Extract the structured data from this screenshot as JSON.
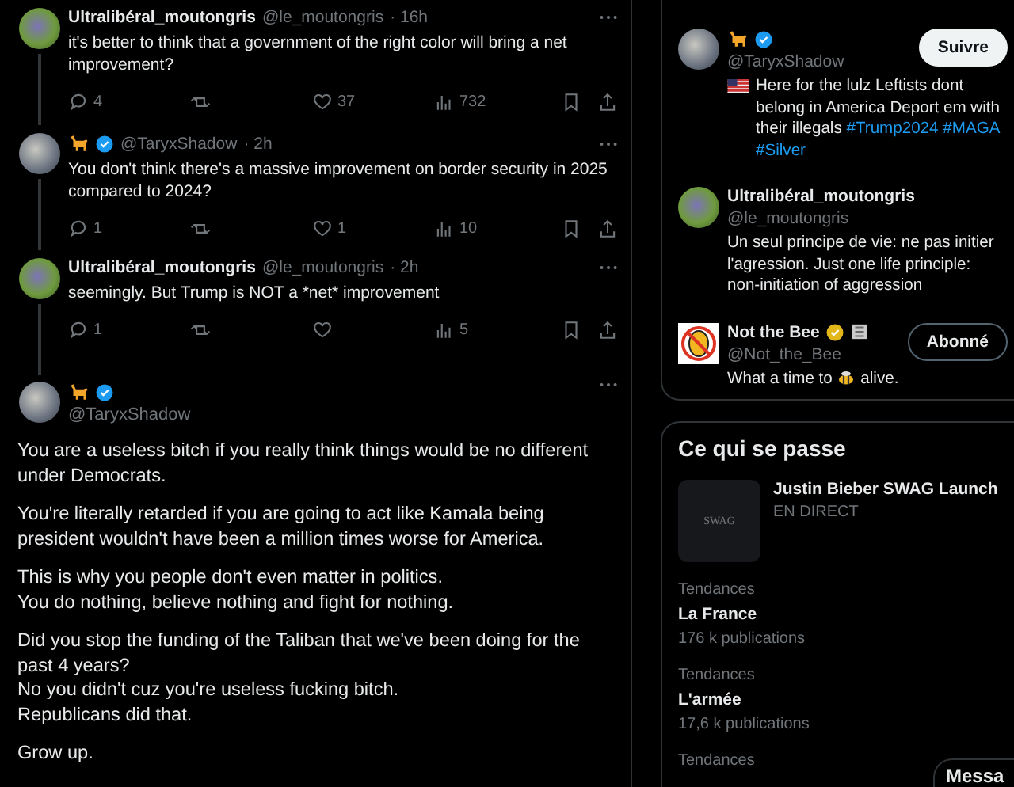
{
  "thread": [
    {
      "kind": "text",
      "name": "Ultralibéral_moutongris",
      "verified": false,
      "handle": "@le_moutongris",
      "time": "· 16h",
      "text": "it's better to think that a government of the right color will bring a net improvement?",
      "replies": "4",
      "likes": "37",
      "views": "732"
    },
    {
      "kind": "cat",
      "verified": {
        "kind": "blue"
      },
      "handle": "@TaryxShadow",
      "time": "· 2h",
      "text": "You don't think there's a massive improvement on border security in 2025 compared to 2024?",
      "replies": "1",
      "likes": "1",
      "views": "10"
    },
    {
      "kind": "text",
      "name": "Ultralibéral_moutongris",
      "verified": false,
      "handle": "@le_moutongris",
      "time": "· 2h",
      "text": "seemingly. But Trump is NOT a *net* improvement",
      "replies": "1",
      "views": "5"
    }
  ],
  "main_tweet": {
    "kind": "cat",
    "verified": {
      "kind": "blue"
    },
    "handle": "@TaryxShadow",
    "paragraphs": [
      "You are a useless bitch if you really think things would be no different under Democrats.",
      "You're literally retarded if you are going to act like Kamala being president wouldn't have been a million times worse for America.",
      "This is why you people don't even matter in politics.\nYou do nothing, believe nothing and fight for nothing.",
      "Did you stop the funding of the Taliban that we've been doing for the past 4 years?\nNo you didn't cuz you're useless fucking bitch.\nRepublicans did that.",
      "Grow up."
    ]
  },
  "who_to_follow": [
    {
      "kind": "cat",
      "verified": {
        "kind": "blue"
      },
      "org_badge": false,
      "handle": "@TaryxShadow",
      "bio": {
        "lead": {
          "kind": "flag"
        },
        "parts": [
          {
            "kind": "text",
            "text": "Here for the lulz Leftists dont belong in America Deport em with their illegals"
          },
          {
            "kind": "hashtag",
            "text": "#Trump2024"
          },
          {
            "kind": "hashtag",
            "text": "#MAGA"
          },
          {
            "kind": "hashtag",
            "text": "#Silver"
          }
        ]
      },
      "button": {
        "label": "Suivre",
        "following": false
      }
    },
    {
      "kind": "text",
      "name": "Ultralibéral_moutongris",
      "verified": false,
      "org_badge": false,
      "handle": "@le_moutongris",
      "bio": {
        "parts": [
          {
            "kind": "text",
            "text": "Un seul principe de vie: ne pas initier l'agression. Just one life principle: non-initiation of aggression"
          }
        ]
      }
    },
    {
      "kind": "logo",
      "name": "Not the Bee",
      "verified": {
        "kind": "gold"
      },
      "org_badge": true,
      "handle": "@Not_the_Bee",
      "bio": {
        "parts": [
          {
            "kind": "text",
            "text": "What a time to"
          },
          {
            "kind": "bee"
          },
          {
            "kind": "text",
            "text": "alive."
          }
        ]
      },
      "button": {
        "label": "Abonné",
        "following": true
      }
    }
  ],
  "trending": {
    "title": "Ce qui se passe",
    "live": {
      "thumb_text": "SWAG",
      "title": "Justin Bieber SWAG Launch",
      "status": "EN DIRECT"
    },
    "trends": [
      {
        "category": "Tendances",
        "name": "La France",
        "posts": "176 k publications"
      },
      {
        "category": "Tendances",
        "name": "L'armée",
        "posts": "17,6 k publications"
      },
      {
        "category": "Tendances"
      }
    ]
  },
  "messages_drawer": {
    "label": "Messa"
  }
}
